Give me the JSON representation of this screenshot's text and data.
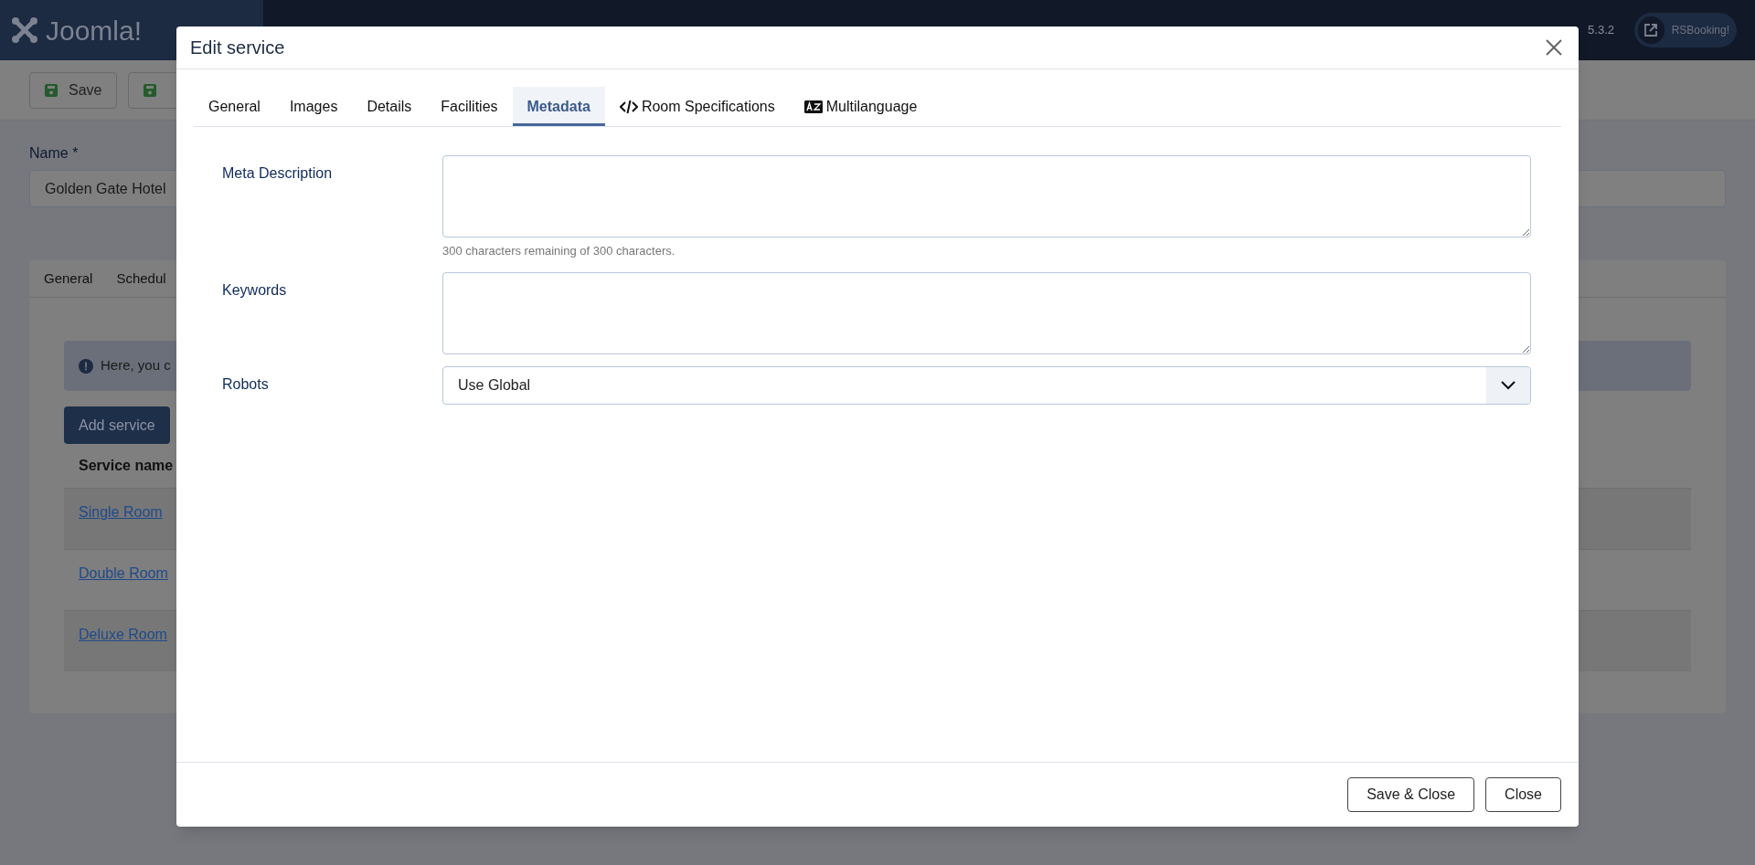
{
  "header": {
    "logo": "Joomla!",
    "version": "5.3.2",
    "site_button": "RSBooking!"
  },
  "toolbar": {
    "buttons": [
      "Save"
    ]
  },
  "name_field": {
    "label": "Name *",
    "value": "Golden Gate Hotel"
  },
  "card": {
    "tabs": [
      {
        "label": "General",
        "selected": false
      },
      {
        "label": "Schedul",
        "selected": false
      }
    ],
    "alert": "Here, you c",
    "add_button": "Add service",
    "column": "Service name",
    "rows": [
      "Single Room",
      "Double Room",
      "Deluxe Room"
    ]
  },
  "modal": {
    "title": "Edit service",
    "tabs": [
      {
        "label": "General",
        "selected": false,
        "kind": "plain"
      },
      {
        "label": "Images",
        "selected": false,
        "kind": "plain"
      },
      {
        "label": "Details",
        "selected": false,
        "kind": "plain"
      },
      {
        "label": "Facilities",
        "selected": false,
        "kind": "plain"
      },
      {
        "label": "Metadata",
        "selected": true,
        "kind": "plain"
      },
      {
        "label": "Room Specifications",
        "selected": false,
        "kind": "code"
      },
      {
        "label": "Multilanguage",
        "selected": false,
        "kind": "language"
      }
    ],
    "fields": [
      {
        "kind": "textarea",
        "label": "Meta Description",
        "hint": "300 characters remaining of 300 characters."
      },
      {
        "kind": "textarea",
        "label": "Keywords"
      },
      {
        "kind": "select",
        "label": "Robots",
        "value": "Use Global"
      }
    ],
    "buttons": [
      "Save & Close",
      "Close"
    ]
  }
}
